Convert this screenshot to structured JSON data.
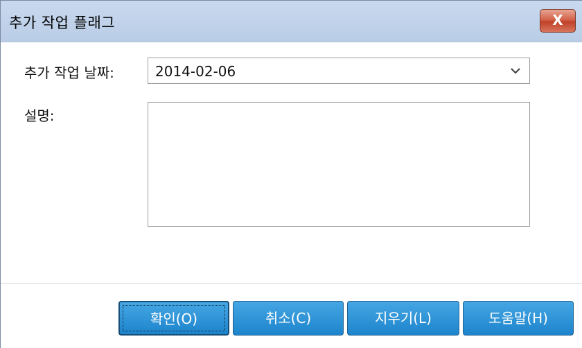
{
  "window": {
    "title": "추가 작업 플래그",
    "close_label": "X"
  },
  "form": {
    "date_label": "추가 작업 날짜:",
    "date_value": "2014-02-06",
    "description_label": "설명:",
    "description_value": ""
  },
  "buttons": {
    "ok": "확인(O)",
    "cancel": "취소(C)",
    "clear": "지우기(L)",
    "help": "도움말(H)"
  },
  "colors": {
    "titlebar": "#c9d9ef",
    "button_blue": "#2b90d6",
    "close_red": "#c94a33"
  }
}
